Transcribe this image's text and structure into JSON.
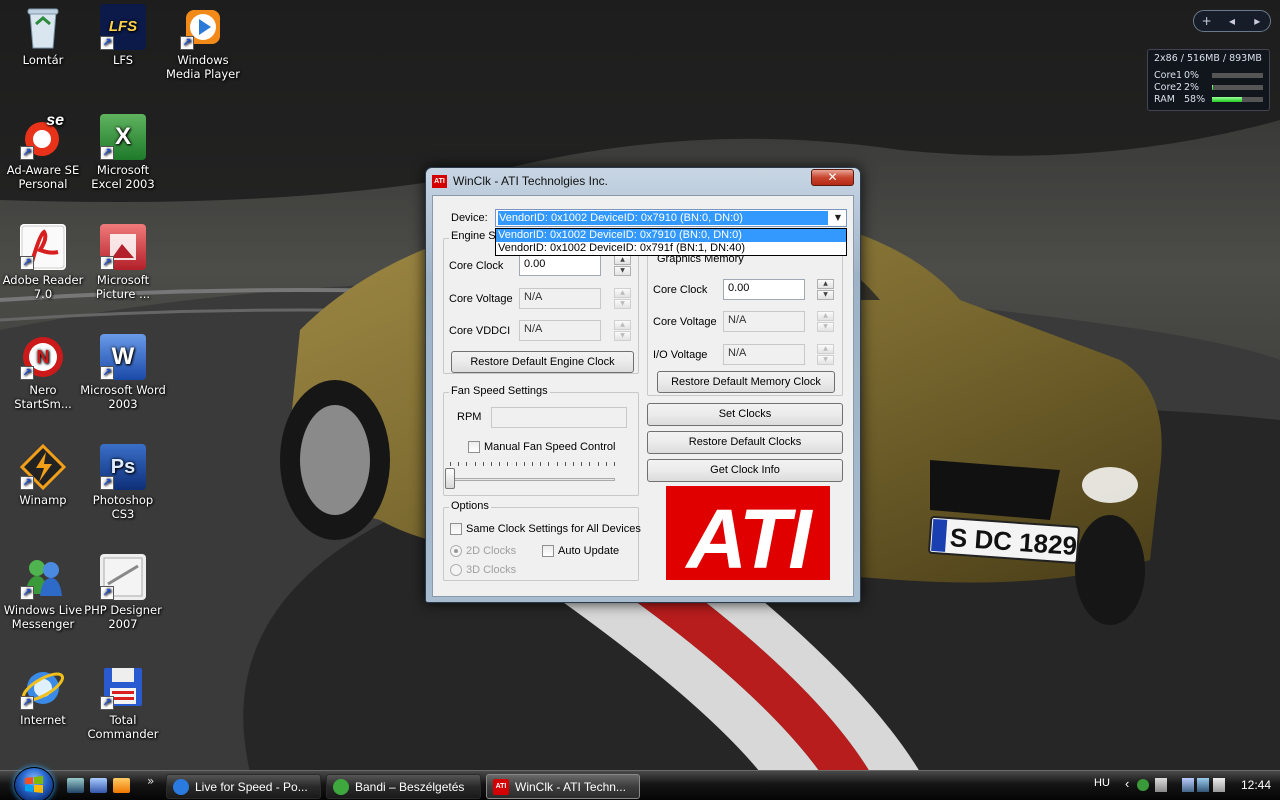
{
  "desktop": {
    "icons": [
      {
        "label": "Lomtár"
      },
      {
        "label": "LFS"
      },
      {
        "label": "Windows Media Player"
      },
      {
        "label": "Ad-Aware SE Personal"
      },
      {
        "label": "Microsoft Excel 2003"
      },
      {
        "label": "Adobe Reader 7.0"
      },
      {
        "label": "Microsoft Picture ..."
      },
      {
        "label": "Nero StartSm..."
      },
      {
        "label": "Microsoft Word 2003"
      },
      {
        "label": "Winamp"
      },
      {
        "label": "Photoshop CS3"
      },
      {
        "label": "Windows Live Messenger"
      },
      {
        "label": "PHP Designer 2007"
      },
      {
        "label": "Internet"
      },
      {
        "label": "Total Commander"
      }
    ],
    "license_plate": "S DC 1829",
    "icon_glyphs": {
      "lfs": "LFS",
      "adaware": "se",
      "ps": "Ps",
      "word": "W",
      "excel": "X",
      "nero": "N"
    }
  },
  "gadgets": {
    "toolbar": {
      "add": "+",
      "prev": "◂",
      "next": "▸"
    },
    "meter": {
      "header": "2x86 / 516MB / 893MB",
      "rows": [
        {
          "label": "Core1",
          "value": "0%",
          "level": 0
        },
        {
          "label": "Core2",
          "value": "2%",
          "level": 0.02
        },
        {
          "label": "RAM",
          "value": "58%",
          "level": 0.58
        }
      ]
    }
  },
  "window": {
    "title": "WinClk - ATI Technolgies Inc.",
    "icon_text": "ATI",
    "close_glyph": "✕",
    "device_label": "Device:",
    "device_selected": "VendorID: 0x1002 DeviceID: 0x7910 (BN:0, DN:0)",
    "device_options": [
      "VendorID: 0x1002 DeviceID: 0x7910 (BN:0, DN:0)",
      "VendorID: 0x1002 DeviceID: 0x791f (BN:1, DN:40)"
    ],
    "engine": {
      "group_title": "Engine S",
      "core_clock_label": "Core Clock",
      "core_clock_value": "0.00",
      "core_voltage_label": "Core Voltage",
      "core_voltage_value": "N/A",
      "core_vddci_label": "Core VDDCI",
      "core_vddci_value": "N/A",
      "restore_button": "Restore Default Engine Clock"
    },
    "memory": {
      "group_title": "Graphics Memory",
      "core_clock_label": "Core Clock",
      "core_clock_value": "0.00",
      "core_voltage_label": "Core Voltage",
      "core_voltage_value": "N/A",
      "io_voltage_label": "I/O Voltage",
      "io_voltage_value": "N/A",
      "restore_button": "Restore Default Memory Clock"
    },
    "fan": {
      "group_title": "Fan Speed Settings",
      "rpm_label": "RPM",
      "rpm_value": "",
      "manual_label": "Manual Fan Speed Control",
      "slider_level": 0
    },
    "options": {
      "group_title": "Options",
      "same_clock_label": "Same Clock Settings for All Devices",
      "clocks_2d": "2D Clocks",
      "clocks_3d": "3D Clocks",
      "auto_update": "Auto Update"
    },
    "buttons": {
      "set_clocks": "Set Clocks",
      "restore_default_clocks": "Restore Default Clocks",
      "get_clock_info": "Get Clock Info"
    },
    "logo_text": "ATI"
  },
  "taskbar": {
    "overflow": "»",
    "tasks": [
      {
        "label": "Live for Speed - Po..."
      },
      {
        "label": "Bandi – Beszélgetés"
      },
      {
        "label": "WinClk - ATI Techn..."
      }
    ],
    "tray": {
      "language": "HU",
      "expand": "‹",
      "clock": "12:44"
    }
  },
  "colors": {
    "ati_red": "#e00000",
    "selection_blue": "#3399ff"
  }
}
